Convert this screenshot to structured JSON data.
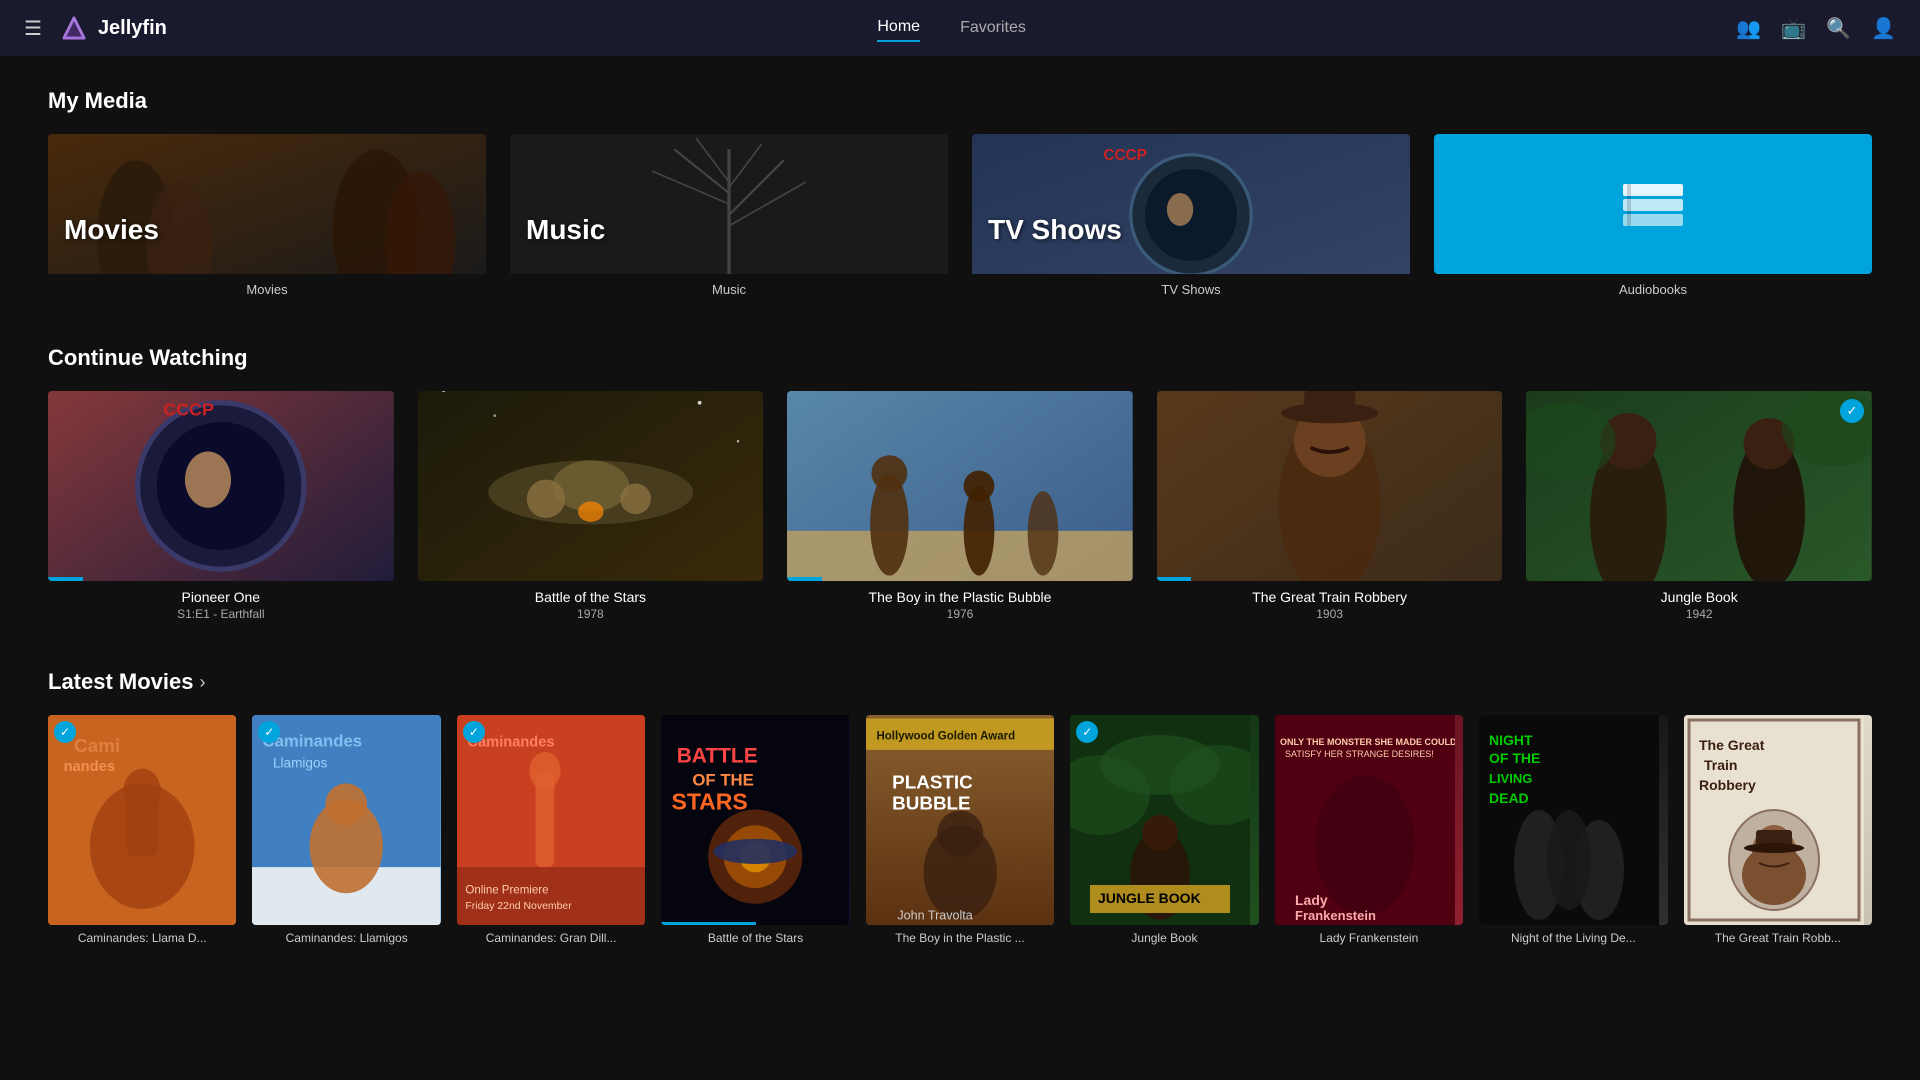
{
  "app": {
    "name": "Jellyfin",
    "logo_alt": "Jellyfin Logo"
  },
  "header": {
    "hamburger_label": "☰",
    "nav": [
      {
        "label": "Home",
        "active": true
      },
      {
        "label": "Favorites",
        "active": false
      }
    ],
    "icons": {
      "users": "👥",
      "cast": "📺",
      "search": "🔍",
      "user": "👤"
    }
  },
  "my_media": {
    "title": "My Media",
    "items": [
      {
        "id": "movies",
        "label": "Movies",
        "subtitle": "Movies"
      },
      {
        "id": "music",
        "label": "Music",
        "subtitle": "Music"
      },
      {
        "id": "tvshows",
        "label": "TV Shows",
        "subtitle": "TV Shows"
      },
      {
        "id": "audiobooks",
        "label": "",
        "subtitle": "Audiobooks",
        "icon": "📚"
      }
    ]
  },
  "continue_watching": {
    "title": "Continue Watching",
    "items": [
      {
        "title": "Pioneer One",
        "subtitle": "S1:E1 - Earthfall",
        "year": "",
        "progress": 10,
        "has_check": false,
        "color": "c-pioneer"
      },
      {
        "title": "Battle of the Stars",
        "subtitle": "1978",
        "progress": 0,
        "has_check": false,
        "color": "c-battle"
      },
      {
        "title": "The Boy in the Plastic Bubble",
        "subtitle": "1976",
        "progress": 10,
        "has_check": false,
        "color": "c-bubble"
      },
      {
        "title": "The Great Train Robbery",
        "subtitle": "1903",
        "progress": 10,
        "has_check": false,
        "color": "c-robbery"
      },
      {
        "title": "Jungle Book",
        "subtitle": "1942",
        "progress": 0,
        "has_check": true,
        "color": "c-jungle"
      }
    ]
  },
  "latest_movies": {
    "title": "Latest Movies",
    "arrow": "›",
    "items": [
      {
        "title": "Caminandes: Llama D...",
        "color": "c-caminandes1",
        "has_check": true,
        "progress": 0
      },
      {
        "title": "Caminandes: Llamigos",
        "color": "c-caminandes2",
        "has_check": true,
        "progress": 0
      },
      {
        "title": "Caminandes: Gran Dill...",
        "color": "c-caminandes3",
        "has_check": true,
        "progress": 0
      },
      {
        "title": "Battle of the Stars",
        "color": "c-battlestars",
        "has_check": false,
        "progress": 50
      },
      {
        "title": "The Boy in the Plastic ...",
        "color": "c-plasticbubble",
        "has_check": false,
        "progress": 0
      },
      {
        "title": "Jungle Book",
        "color": "c-junglebook2",
        "has_check": true,
        "progress": 0
      },
      {
        "title": "Lady Frankenstein",
        "color": "c-ladyfrank",
        "has_check": false,
        "progress": 0
      },
      {
        "title": "Night of the Living De...",
        "color": "c-nightliving",
        "has_check": false,
        "progress": 0
      },
      {
        "title": "The Great Train Robb...",
        "color": "c-greattrain2",
        "has_check": false,
        "progress": 0
      }
    ]
  }
}
